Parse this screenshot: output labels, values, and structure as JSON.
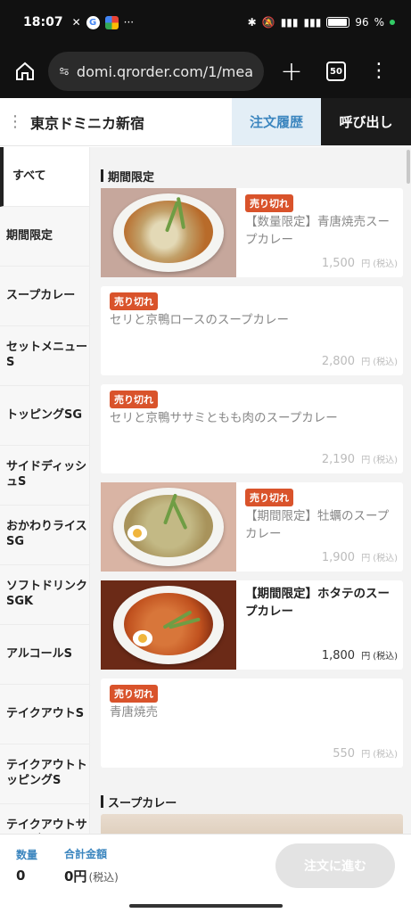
{
  "status": {
    "time": "18:07",
    "x_icon": "✕",
    "more": "···",
    "battery": "96"
  },
  "browser": {
    "url": "domi.qrorder.com/1/mea",
    "tabs_count": "50"
  },
  "header": {
    "shop_name": "東京ドミニカ新宿",
    "history_label": "注文履歴",
    "call_label": "呼び出し"
  },
  "sidebar": {
    "items": [
      {
        "label": "すべて"
      },
      {
        "label": "期間限定"
      },
      {
        "label": "スープカレー"
      },
      {
        "label": "セットメニューS"
      },
      {
        "label": "トッピングSG"
      },
      {
        "label": "サイドディッシュS"
      },
      {
        "label": "おかわりライスSG"
      },
      {
        "label": "ソフトドリンクSGK"
      },
      {
        "label": "アルコールS"
      },
      {
        "label": "テイクアウトS"
      },
      {
        "label": "テイクアウトトッピングS"
      },
      {
        "label": "テイクアウトサイドディ"
      }
    ]
  },
  "sections": {
    "limited": "期間限定",
    "soup": "スープカレー"
  },
  "items": [
    {
      "badge": "売り切れ",
      "name": "【数量限定】青唐焼売スープカレー",
      "price": "1,500",
      "unit": "円",
      "tax": "(税込)"
    },
    {
      "badge": "売り切れ",
      "name": "セリと京鴨ロースのスープカレー",
      "price": "2,800",
      "unit": "円",
      "tax": "(税込)"
    },
    {
      "badge": "売り切れ",
      "name": "セリと京鴨ササミともも肉のスープカレー",
      "price": "2,190",
      "unit": "円",
      "tax": "(税込)"
    },
    {
      "badge": "売り切れ",
      "name": "【期間限定】牡蠣のスープカレー",
      "price": "1,900",
      "unit": "円",
      "tax": "(税込)"
    },
    {
      "badge": "",
      "name": "【期間限定】ホタテのスープカレー",
      "price": "1,800",
      "unit": "円",
      "tax": "(税込)"
    },
    {
      "badge": "売り切れ",
      "name": "青唐焼売",
      "price": "550",
      "unit": "円",
      "tax": "(税込)"
    }
  ],
  "footer": {
    "qty_label": "数量",
    "qty_value": "0",
    "total_label": "合計金額",
    "total_value": "0円",
    "total_tax": "(税込)",
    "order_button": "注文に進む"
  }
}
